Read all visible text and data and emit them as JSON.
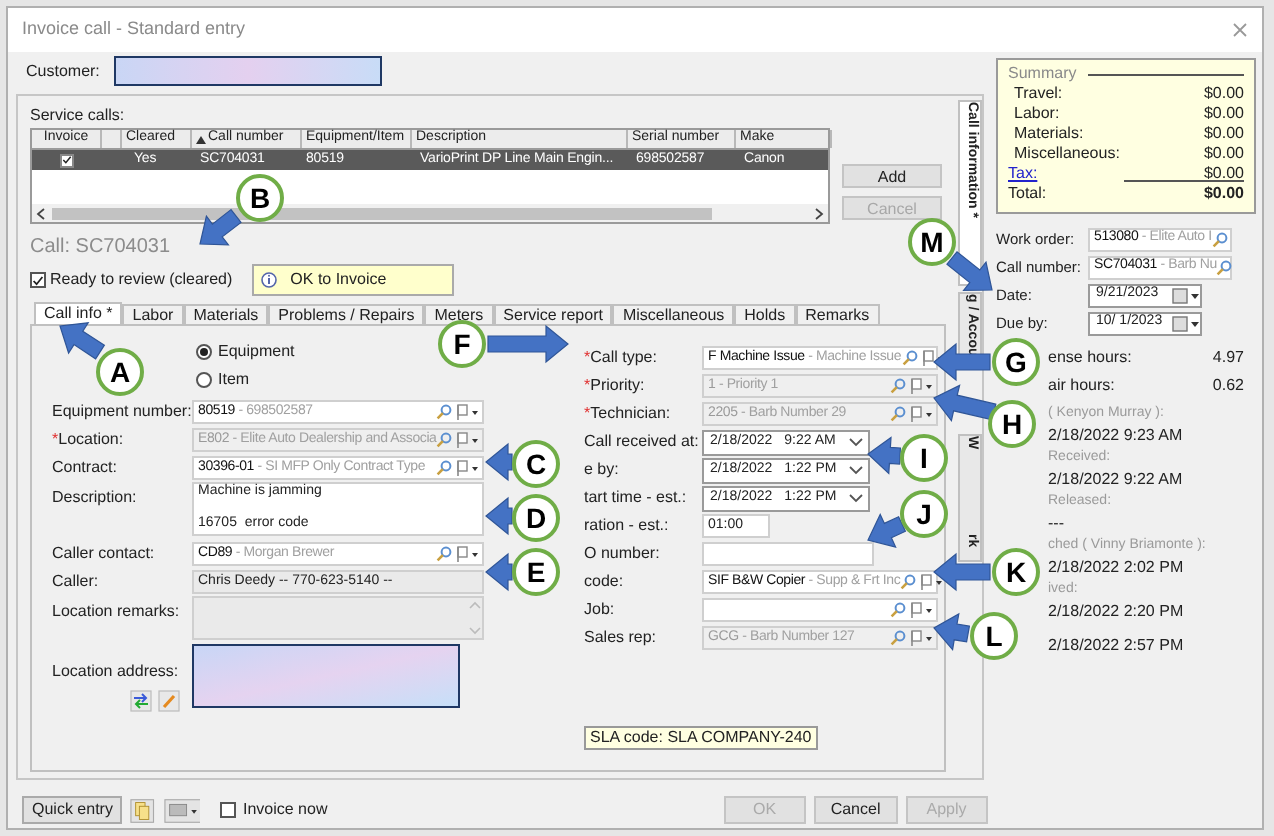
{
  "window": {
    "title": "Invoice call - Standard entry"
  },
  "customer": {
    "label": "Customer:"
  },
  "service_calls": {
    "label": "Service calls:",
    "columns": [
      {
        "label": "Invoice",
        "sorted": false
      },
      {
        "label": "Cleared",
        "sorted": false
      },
      {
        "label": "Call number",
        "sorted": true
      },
      {
        "label": "Equipment/Item",
        "sorted": false
      },
      {
        "label": "Description",
        "sorted": false
      },
      {
        "label": "Serial number",
        "sorted": false
      },
      {
        "label": "Make",
        "sorted": false
      }
    ],
    "rows": [
      {
        "invoice": true,
        "selected": true,
        "cells": [
          "",
          "Yes",
          "SC704031",
          "80519",
          "VarioPrint DP Line Main Engin...",
          "698502587",
          "Canon"
        ]
      }
    ],
    "buttons": [
      {
        "label": "Add",
        "disabled": false
      },
      {
        "label": "Cancel",
        "disabled": true
      }
    ]
  },
  "call_heading": "Call: SC704031",
  "ready_to_review": {
    "label": "Ready to review (cleared)",
    "checked": true
  },
  "status_note": "OK to Invoice",
  "tabs": [
    {
      "label": "Call info *",
      "selected": true
    },
    {
      "label": "Labor",
      "selected": false
    },
    {
      "label": "Materials",
      "selected": false
    },
    {
      "label": "Problems / Repairs",
      "selected": false
    },
    {
      "label": "Meters",
      "selected": false
    },
    {
      "label": "Service report",
      "selected": false
    },
    {
      "label": "Miscellaneous",
      "selected": false
    },
    {
      "label": "Holds",
      "selected": false
    },
    {
      "label": "Remarks",
      "selected": false
    }
  ],
  "item_type": [
    {
      "label": "Equipment",
      "selected": true
    },
    {
      "label": "Item",
      "selected": false
    }
  ],
  "left_fields": [
    {
      "kind": "lookup",
      "label": "Equipment number:",
      "required": false,
      "code": "80519",
      "name": "- 698502587",
      "disabled": false
    },
    {
      "kind": "lookup",
      "label": "*Location:",
      "required": true,
      "code": "E802",
      "name": "- Elite Auto Dealership and Associa",
      "disabled": true
    },
    {
      "kind": "lookup",
      "label": "Contract:",
      "required": false,
      "code": "30396-01",
      "name": "- SI MFP Only Contract Type",
      "disabled": false
    },
    {
      "kind": "textarea",
      "label": "Description:",
      "value": "Machine is jamming\n\n16705  error code"
    },
    {
      "kind": "lookup",
      "label": "Caller contact:",
      "required": false,
      "code": "CD89",
      "name": "- Morgan Brewer",
      "disabled": false
    },
    {
      "kind": "readonly",
      "label": "Caller:",
      "value": "Chris Deedy -- 770-623-5140 --"
    },
    {
      "kind": "readonly_area",
      "label": "Location remarks:"
    },
    {
      "kind": "address",
      "label": "Location address:"
    }
  ],
  "right_fields": [
    {
      "kind": "lookup",
      "label": "*Call type:",
      "required": true,
      "code": "F Machine Issue",
      "name": "- Machine Issue",
      "disabled": false
    },
    {
      "kind": "lookup",
      "label": "*Priority:",
      "required": true,
      "code": "1",
      "name": "- Priority 1",
      "disabled": true
    },
    {
      "kind": "lookup",
      "label": "*Technician:",
      "required": true,
      "code": "2205",
      "name": "- Barb Number 29",
      "disabled": true
    },
    {
      "kind": "datetime",
      "label": "Call received at:",
      "date": "2/18/2022",
      "time": "9:22 AM"
    },
    {
      "kind": "datetime",
      "label": "e by:",
      "date": "2/18/2022",
      "time": "1:22 PM"
    },
    {
      "kind": "datetime",
      "label": "tart time - est.:",
      "date": "2/18/2022",
      "time": "1:22 PM"
    },
    {
      "kind": "short_text",
      "label": "ration - est.:",
      "value": "01:00"
    },
    {
      "kind": "text",
      "label": "O number:"
    },
    {
      "kind": "lookup",
      "label": "code:",
      "required": false,
      "code": "SIF B&W Copier",
      "name": "- Supp & Frt Inc",
      "disabled": false
    },
    {
      "kind": "lookup",
      "label": "Job:",
      "required": false,
      "disabled": false
    },
    {
      "kind": "lookup",
      "label": "Sales rep:",
      "required": false,
      "code": "GCG",
      "name": "- Barb Number 127",
      "disabled": true
    }
  ],
  "sla_note": "SLA code: SLA COMPANY-240",
  "side_tabs": [
    {
      "label": "Call information *",
      "selected": true
    },
    {
      "label": "g / Accou",
      "selected": false
    },
    {
      "label": "W",
      "label_end": "rk",
      "selected": false
    }
  ],
  "bottom": {
    "quick_entry": "Quick entry",
    "invoice_now": {
      "label": "Invoice now",
      "checked": false
    },
    "buttons": [
      {
        "label": "OK",
        "disabled": true
      },
      {
        "label": "Cancel",
        "disabled": false
      },
      {
        "label": "Apply",
        "disabled": true
      }
    ]
  },
  "summary": {
    "title": "Summary",
    "rows": [
      {
        "label": "Travel:",
        "value": "$0.00",
        "kind": "plain"
      },
      {
        "label": "Labor:",
        "value": "$0.00",
        "kind": "plain"
      },
      {
        "label": "Materials:",
        "value": "$0.00",
        "kind": "plain"
      },
      {
        "label": "Miscellaneous:",
        "value": "$0.00",
        "kind": "plain"
      },
      {
        "label": "Tax:",
        "value": "$0.00",
        "kind": "link"
      }
    ],
    "total": {
      "label": "Total:",
      "value": "$0.00"
    }
  },
  "side_fields": [
    {
      "kind": "lookup",
      "label": "Work order:",
      "code": "513080",
      "name": "- Elite Auto I"
    },
    {
      "kind": "lookup",
      "label": "Call number:",
      "code": "SC704031",
      "name": "- Barb Nu"
    },
    {
      "kind": "date",
      "label": "Date:",
      "value": "9/21/2023"
    },
    {
      "kind": "date",
      "label": "Due by:",
      "value": "10/ 1/2023"
    }
  ],
  "hours": [
    {
      "label": "ense hours:",
      "value": "4.97"
    },
    {
      "label": "air hours:",
      "value": "0.62"
    }
  ],
  "history": [
    {
      "label": "( Kenyon Murray ):",
      "value": "2/18/2022 9:23 AM"
    },
    {
      "label": "Received:",
      "value": "2/18/2022 9:22 AM"
    },
    {
      "label": "Released:",
      "value": "---"
    },
    {
      "label": "ched ( Vinny Briamonte ):",
      "value": "2/18/2022 2:02 PM"
    },
    {
      "label": "ived:",
      "value": "2/18/2022 2:20 PM"
    },
    {
      "value": "2/18/2022 2:57 PM"
    }
  ],
  "callouts": [
    {
      "letter": "A"
    },
    {
      "letter": "B"
    },
    {
      "letter": "C"
    },
    {
      "letter": "D"
    },
    {
      "letter": "E"
    },
    {
      "letter": "F"
    },
    {
      "letter": "G"
    },
    {
      "letter": "H"
    },
    {
      "letter": "I"
    },
    {
      "letter": "J"
    },
    {
      "letter": "K"
    },
    {
      "letter": "L"
    },
    {
      "letter": "M"
    }
  ]
}
